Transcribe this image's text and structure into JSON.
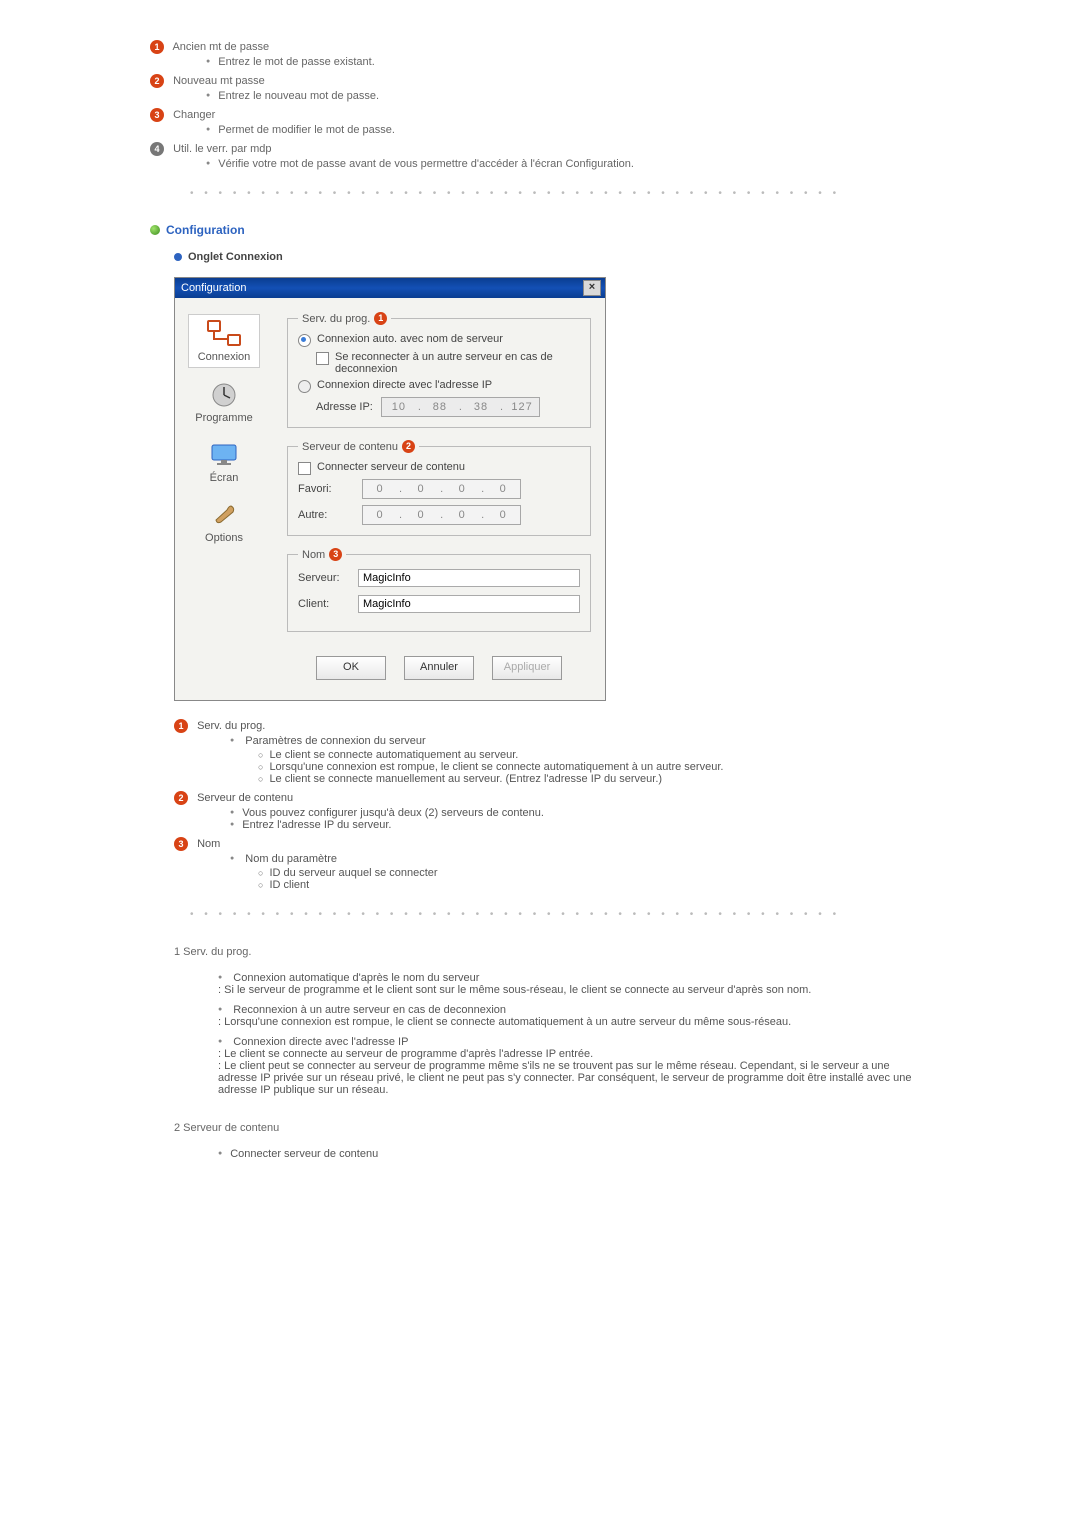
{
  "top_items": [
    {
      "num": "1",
      "title": "Ancien mt de passe",
      "sub": [
        "Entrez le mot de passe existant."
      ]
    },
    {
      "num": "2",
      "title": "Nouveau mt passe",
      "sub": [
        "Entrez le nouveau mot de passe."
      ]
    },
    {
      "num": "3",
      "title": "Changer",
      "sub": [
        "Permet de modifier le mot de passe."
      ]
    },
    {
      "num": "4",
      "grey": true,
      "title": "Util. le verr. par mdp",
      "sub": [
        "Vérifie votre mot de passe avant de vous permettre d'accéder à l'écran Configuration."
      ]
    }
  ],
  "sep": "• • • • • • • • • • • • • • • • • • • • • • • • • • • • • • • • • • • • • • • • • • • • • •",
  "section_title": "Configuration",
  "sub_section_title": "Onglet Connexion",
  "dialog": {
    "title": "Configuration",
    "sidebar": {
      "items": [
        {
          "label": "Connexion"
        },
        {
          "label": "Programme"
        },
        {
          "label": "Écran"
        },
        {
          "label": "Options"
        }
      ]
    },
    "group1": {
      "legend": "Serv. du prog.",
      "num": "1",
      "opt_auto": "Connexion auto. avec nom de serveur",
      "opt_reconnect": "Se reconnecter à un autre serveur en cas de deconnexion",
      "opt_direct": "Connexion directe avec l'adresse IP",
      "ip_label": "Adresse IP:",
      "ip": [
        "10",
        "88",
        "38",
        "127"
      ]
    },
    "group2": {
      "legend": "Serveur de contenu",
      "num": "2",
      "connect": "Connecter serveur de contenu",
      "fav_label": "Favori:",
      "other_label": "Autre:",
      "ip_zero": [
        "0",
        "0",
        "0",
        "0"
      ]
    },
    "group3": {
      "legend": "Nom",
      "num": "3",
      "server_label": "Serveur:",
      "server_val": "MagicInfo",
      "client_label": "Client:",
      "client_val": "MagicInfo"
    },
    "buttons": {
      "ok": "OK",
      "cancel": "Annuler",
      "apply": "Appliquer"
    }
  },
  "explain": [
    {
      "num": "1",
      "title": "Serv. du prog.",
      "bullets": [
        {
          "text": "Paramètres de connexion du serveur",
          "circles": [
            "Le client se connecte automatiquement au serveur.",
            "Lorsqu'une connexion est rompue, le client se connecte automatiquement à un autre serveur.",
            "Le client se connecte manuellement au serveur. (Entrez l'adresse IP du serveur.)"
          ]
        }
      ]
    },
    {
      "num": "2",
      "title": "Serveur de contenu",
      "bullets": [
        {
          "text": "Vous pouvez configurer jusqu'à deux (2) serveurs de contenu."
        },
        {
          "text": "Entrez l'adresse IP du serveur."
        }
      ]
    },
    {
      "num": "3",
      "title": "Nom",
      "bullets": [
        {
          "text": "Nom du paramètre",
          "circles": [
            "ID du serveur auquel se connecter",
            "ID client"
          ]
        }
      ]
    }
  ],
  "notes": {
    "n1": {
      "head": "1   Serv. du prog.",
      "items": [
        {
          "lead": "Connexion automatique d'après le nom du serveur",
          "body": ": Si le serveur de programme et le client sont sur le même sous-réseau, le client se connecte au serveur d'après son nom."
        },
        {
          "lead": "Reconnexion à un autre serveur en cas de deconnexion",
          "body": ": Lorsqu'une connexion est rompue, le client se connecte automatiquement à un autre serveur du même sous-réseau."
        },
        {
          "lead": "Connexion directe avec l'adresse IP",
          "body": ": Le client se connecte au serveur de programme d'après l'adresse IP entrée.",
          "body2": ": Le client peut se connecter au serveur de programme même s'ils ne se trouvent pas sur le même réseau. Cependant, si le serveur a une adresse IP privée sur un réseau privé, le client ne peut pas s'y connecter. Par conséquent, le serveur de programme doit être installé avec une adresse IP publique sur un réseau."
        }
      ]
    },
    "n2": {
      "head": "2   Serveur de contenu",
      "items": [
        {
          "lead": "Connecter serveur de contenu"
        }
      ]
    }
  }
}
